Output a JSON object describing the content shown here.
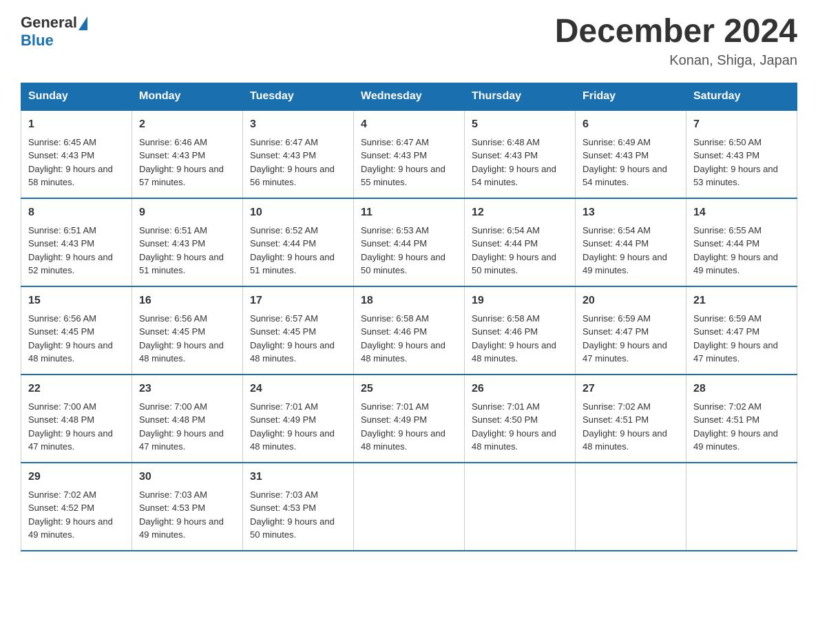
{
  "header": {
    "logo_general": "General",
    "logo_blue": "Blue",
    "month_title": "December 2024",
    "location": "Konan, Shiga, Japan"
  },
  "weekdays": [
    "Sunday",
    "Monday",
    "Tuesday",
    "Wednesday",
    "Thursday",
    "Friday",
    "Saturday"
  ],
  "weeks": [
    [
      {
        "day": "1",
        "sunrise": "6:45 AM",
        "sunset": "4:43 PM",
        "daylight": "9 hours and 58 minutes."
      },
      {
        "day": "2",
        "sunrise": "6:46 AM",
        "sunset": "4:43 PM",
        "daylight": "9 hours and 57 minutes."
      },
      {
        "day": "3",
        "sunrise": "6:47 AM",
        "sunset": "4:43 PM",
        "daylight": "9 hours and 56 minutes."
      },
      {
        "day": "4",
        "sunrise": "6:47 AM",
        "sunset": "4:43 PM",
        "daylight": "9 hours and 55 minutes."
      },
      {
        "day": "5",
        "sunrise": "6:48 AM",
        "sunset": "4:43 PM",
        "daylight": "9 hours and 54 minutes."
      },
      {
        "day": "6",
        "sunrise": "6:49 AM",
        "sunset": "4:43 PM",
        "daylight": "9 hours and 54 minutes."
      },
      {
        "day": "7",
        "sunrise": "6:50 AM",
        "sunset": "4:43 PM",
        "daylight": "9 hours and 53 minutes."
      }
    ],
    [
      {
        "day": "8",
        "sunrise": "6:51 AM",
        "sunset": "4:43 PM",
        "daylight": "9 hours and 52 minutes."
      },
      {
        "day": "9",
        "sunrise": "6:51 AM",
        "sunset": "4:43 PM",
        "daylight": "9 hours and 51 minutes."
      },
      {
        "day": "10",
        "sunrise": "6:52 AM",
        "sunset": "4:44 PM",
        "daylight": "9 hours and 51 minutes."
      },
      {
        "day": "11",
        "sunrise": "6:53 AM",
        "sunset": "4:44 PM",
        "daylight": "9 hours and 50 minutes."
      },
      {
        "day": "12",
        "sunrise": "6:54 AM",
        "sunset": "4:44 PM",
        "daylight": "9 hours and 50 minutes."
      },
      {
        "day": "13",
        "sunrise": "6:54 AM",
        "sunset": "4:44 PM",
        "daylight": "9 hours and 49 minutes."
      },
      {
        "day": "14",
        "sunrise": "6:55 AM",
        "sunset": "4:44 PM",
        "daylight": "9 hours and 49 minutes."
      }
    ],
    [
      {
        "day": "15",
        "sunrise": "6:56 AM",
        "sunset": "4:45 PM",
        "daylight": "9 hours and 48 minutes."
      },
      {
        "day": "16",
        "sunrise": "6:56 AM",
        "sunset": "4:45 PM",
        "daylight": "9 hours and 48 minutes."
      },
      {
        "day": "17",
        "sunrise": "6:57 AM",
        "sunset": "4:45 PM",
        "daylight": "9 hours and 48 minutes."
      },
      {
        "day": "18",
        "sunrise": "6:58 AM",
        "sunset": "4:46 PM",
        "daylight": "9 hours and 48 minutes."
      },
      {
        "day": "19",
        "sunrise": "6:58 AM",
        "sunset": "4:46 PM",
        "daylight": "9 hours and 48 minutes."
      },
      {
        "day": "20",
        "sunrise": "6:59 AM",
        "sunset": "4:47 PM",
        "daylight": "9 hours and 47 minutes."
      },
      {
        "day": "21",
        "sunrise": "6:59 AM",
        "sunset": "4:47 PM",
        "daylight": "9 hours and 47 minutes."
      }
    ],
    [
      {
        "day": "22",
        "sunrise": "7:00 AM",
        "sunset": "4:48 PM",
        "daylight": "9 hours and 47 minutes."
      },
      {
        "day": "23",
        "sunrise": "7:00 AM",
        "sunset": "4:48 PM",
        "daylight": "9 hours and 47 minutes."
      },
      {
        "day": "24",
        "sunrise": "7:01 AM",
        "sunset": "4:49 PM",
        "daylight": "9 hours and 48 minutes."
      },
      {
        "day": "25",
        "sunrise": "7:01 AM",
        "sunset": "4:49 PM",
        "daylight": "9 hours and 48 minutes."
      },
      {
        "day": "26",
        "sunrise": "7:01 AM",
        "sunset": "4:50 PM",
        "daylight": "9 hours and 48 minutes."
      },
      {
        "day": "27",
        "sunrise": "7:02 AM",
        "sunset": "4:51 PM",
        "daylight": "9 hours and 48 minutes."
      },
      {
        "day": "28",
        "sunrise": "7:02 AM",
        "sunset": "4:51 PM",
        "daylight": "9 hours and 49 minutes."
      }
    ],
    [
      {
        "day": "29",
        "sunrise": "7:02 AM",
        "sunset": "4:52 PM",
        "daylight": "9 hours and 49 minutes."
      },
      {
        "day": "30",
        "sunrise": "7:03 AM",
        "sunset": "4:53 PM",
        "daylight": "9 hours and 49 minutes."
      },
      {
        "day": "31",
        "sunrise": "7:03 AM",
        "sunset": "4:53 PM",
        "daylight": "9 hours and 50 minutes."
      },
      null,
      null,
      null,
      null
    ]
  ],
  "labels": {
    "sunrise": "Sunrise:",
    "sunset": "Sunset:",
    "daylight": "Daylight:"
  }
}
